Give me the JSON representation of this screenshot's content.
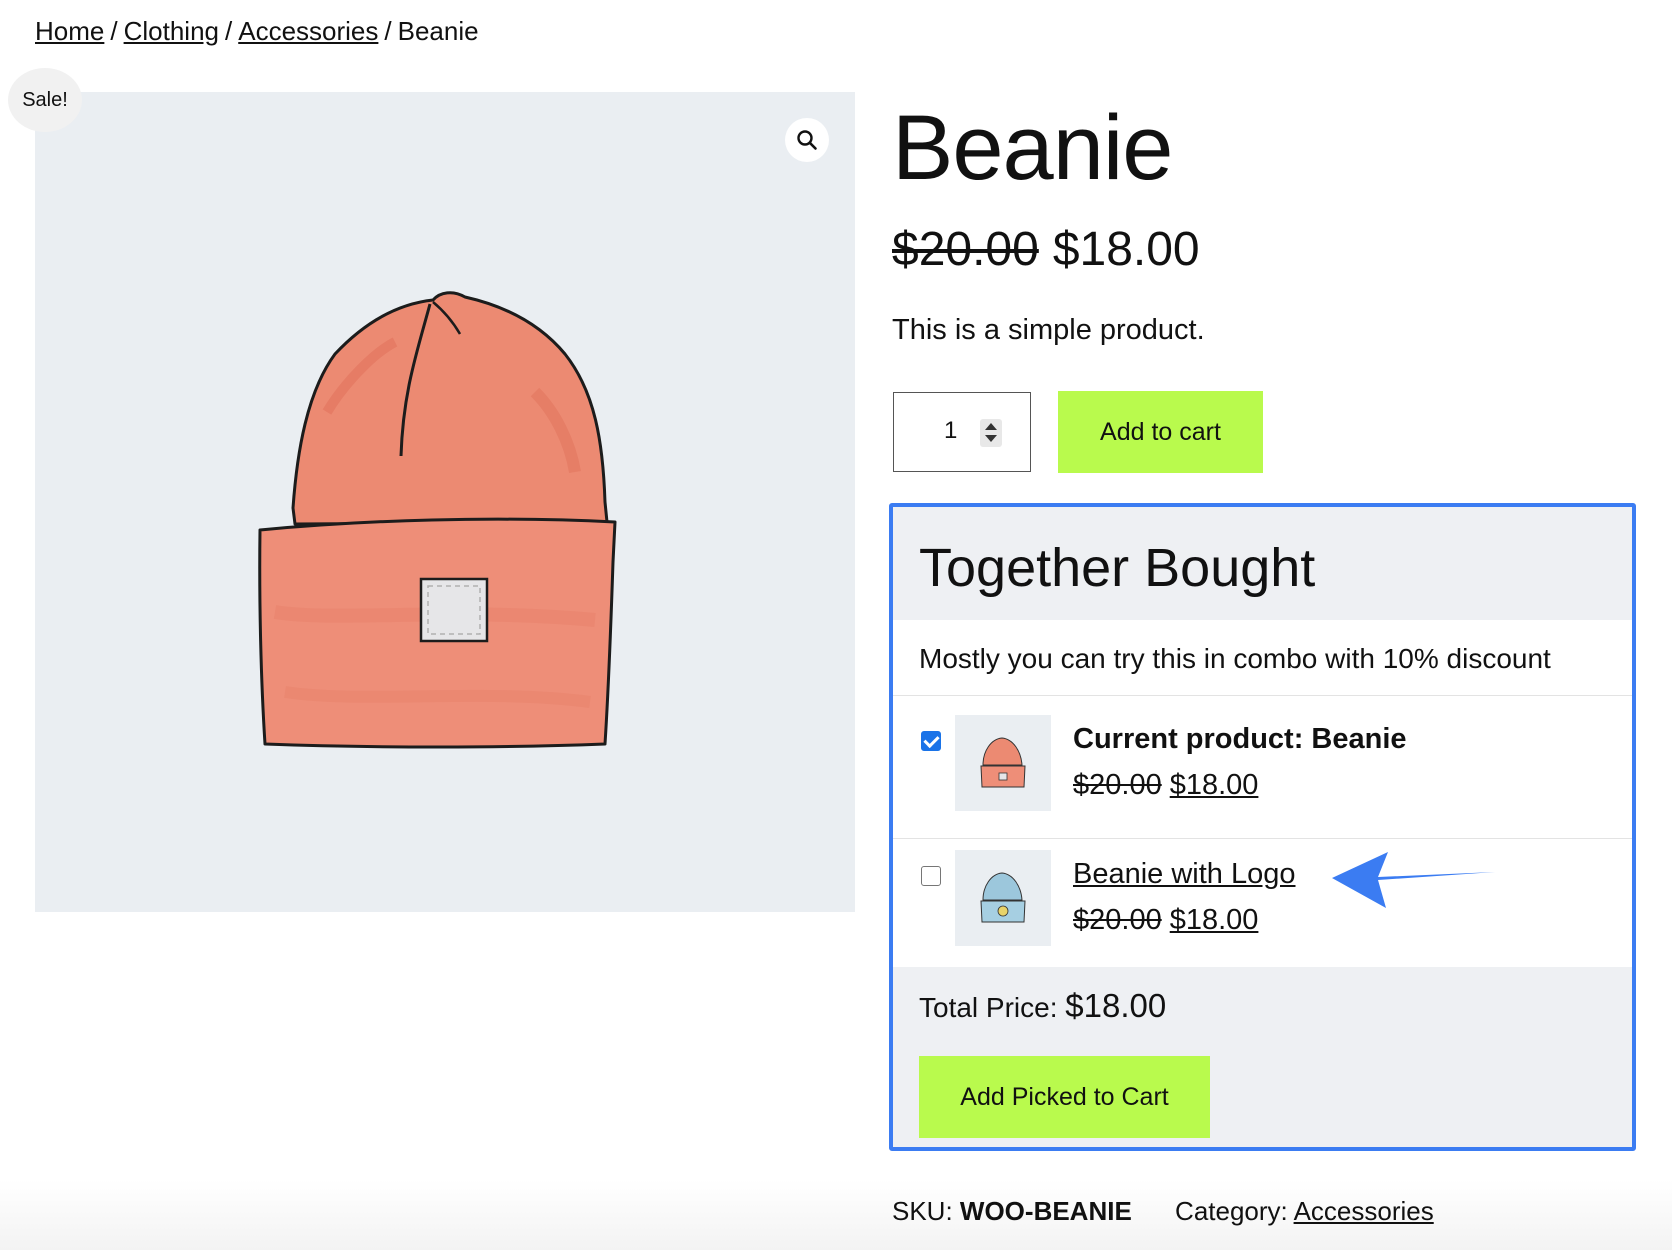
{
  "breadcrumb": {
    "items": [
      "Home",
      "Clothing",
      "Accessories"
    ],
    "separator": "/",
    "current": "Beanie"
  },
  "gallery": {
    "sale_badge": "Sale!",
    "zoom_icon": "search-icon",
    "image": "beanie-orange-image"
  },
  "product": {
    "title": "Beanie",
    "regular_price": "$20.00",
    "sale_price": "$18.00",
    "short_description": "This is a simple product.",
    "quantity": "1",
    "add_to_cart_label": "Add to cart"
  },
  "together_bought": {
    "title": "Together Bought",
    "description": "Mostly you can try this in combo with 10% discount",
    "items": [
      {
        "name": "Current product: Beanie",
        "regular_price": "$20.00",
        "sale_price": "$18.00",
        "checked": true,
        "thumb": "beanie-orange-thumb"
      },
      {
        "name": "Beanie with Logo",
        "regular_price": "$20.00",
        "sale_price": "$18.00",
        "checked": false,
        "thumb": "beanie-blue-logo-thumb"
      }
    ],
    "total_label": "Total Price:",
    "total_value": "$18.00",
    "add_picked_label": "Add Picked to Cart",
    "highlight_color": "#3b7cf2"
  },
  "meta": {
    "sku_label": "SKU:",
    "sku_value": "WOO-BEANIE",
    "category_label": "Category:",
    "category_value": "Accessories"
  },
  "colors": {
    "button_bg": "#b9fa4d",
    "accent_blue": "#3b7cf2",
    "image_bg": "#eaeef2"
  }
}
